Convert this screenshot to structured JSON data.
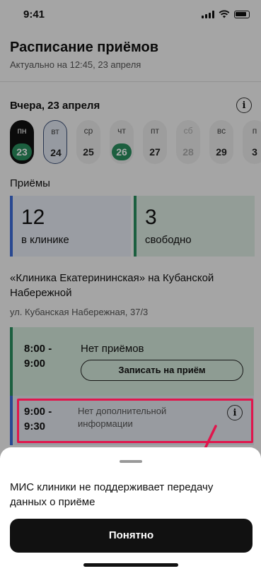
{
  "status_bar": {
    "time": "9:41"
  },
  "header": {
    "title": "Расписание приёмов",
    "subtitle": "Актуально на 12:45, 23 апреля"
  },
  "day_heading": "Вчера, 23 апреля",
  "days": [
    {
      "dow": "пн",
      "num": "23",
      "state": "selected"
    },
    {
      "dow": "вт",
      "num": "24",
      "state": "today"
    },
    {
      "dow": "ср",
      "num": "25",
      "state": "normal"
    },
    {
      "dow": "чт",
      "num": "26",
      "state": "green"
    },
    {
      "dow": "пт",
      "num": "27",
      "state": "normal"
    },
    {
      "dow": "сб",
      "num": "28",
      "state": "weekend"
    },
    {
      "dow": "вс",
      "num": "29",
      "state": "normal"
    },
    {
      "dow": "п",
      "num": "3",
      "state": "normal"
    }
  ],
  "appointments": {
    "label": "Приёмы",
    "in_clinic_count": "12",
    "in_clinic_label": "в клинике",
    "free_count": "3",
    "free_label": "свободно"
  },
  "clinic": {
    "name": "«Клиника Екатерининская» на Кубанской Набережной",
    "address": "ул. Кубанская Набережная, 37/3"
  },
  "slots": [
    {
      "time": "8:00 - 9:00",
      "text": "Нет приёмов",
      "button": "Записать на приём"
    },
    {
      "time": "9:00 - 9:30",
      "text": "Нет дополнительной информации"
    }
  ],
  "sheet": {
    "message": "МИС клиники не поддерживает передачу данных о приёме",
    "ok_label": "Понятно"
  },
  "colors": {
    "accent_green": "#2a8d5e",
    "accent_blue": "#3b6bd6",
    "highlight": "#e0164c"
  }
}
